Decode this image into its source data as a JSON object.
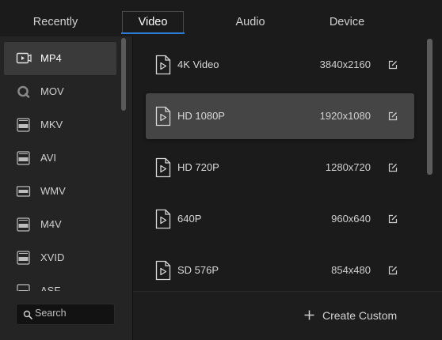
{
  "tabs": [
    {
      "label": "Recently"
    },
    {
      "label": "Video"
    },
    {
      "label": "Audio"
    },
    {
      "label": "Device"
    }
  ],
  "active_tab": "Video",
  "colors": {
    "accent": "#2e7bd6",
    "selected_row": "#454545",
    "selected_format": "#3a3a3a"
  },
  "formats": [
    {
      "label": "MP4",
      "icon": "mp4-file-icon",
      "selected": true
    },
    {
      "label": "MOV",
      "icon": "mov-quicktime-icon"
    },
    {
      "label": "MKV",
      "icon": "mkv-file-icon"
    },
    {
      "label": "AVI",
      "icon": "avi-file-icon"
    },
    {
      "label": "WMV",
      "icon": "wmv-file-icon"
    },
    {
      "label": "M4V",
      "icon": "m4v-file-icon"
    },
    {
      "label": "XVID",
      "icon": "xvid-file-icon"
    },
    {
      "label": "ASF",
      "icon": "asf-file-icon"
    }
  ],
  "search": {
    "placeholder": "Search"
  },
  "presets": [
    {
      "name": "4K Video",
      "resolution": "3840x2160"
    },
    {
      "name": "HD 1080P",
      "resolution": "1920x1080",
      "selected": true
    },
    {
      "name": "HD 720P",
      "resolution": "1280x720"
    },
    {
      "name": "640P",
      "resolution": "960x640"
    },
    {
      "name": "SD 576P",
      "resolution": "854x480"
    }
  ],
  "footer": {
    "create_label": "Create Custom"
  }
}
